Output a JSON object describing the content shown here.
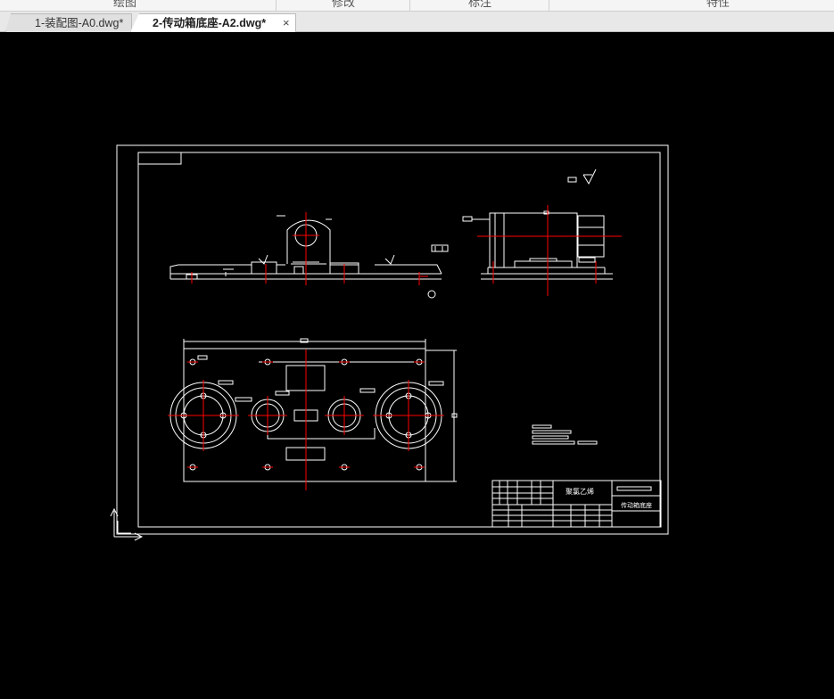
{
  "ribbon": {
    "groups": [
      "绘图",
      "修改",
      "标注",
      "特性"
    ]
  },
  "tabs": [
    {
      "label": "1-装配图-A0.dwg*"
    },
    {
      "label": "2-传动箱底座-A2.dwg*",
      "close": "×"
    }
  ],
  "drawing": {
    "title_block": {
      "material": "聚氯乙烯",
      "part_name": "传动箱底座"
    }
  },
  "colors": {
    "background": "#000000",
    "lines": "#ffffff",
    "centerlines": "#ff0000"
  }
}
